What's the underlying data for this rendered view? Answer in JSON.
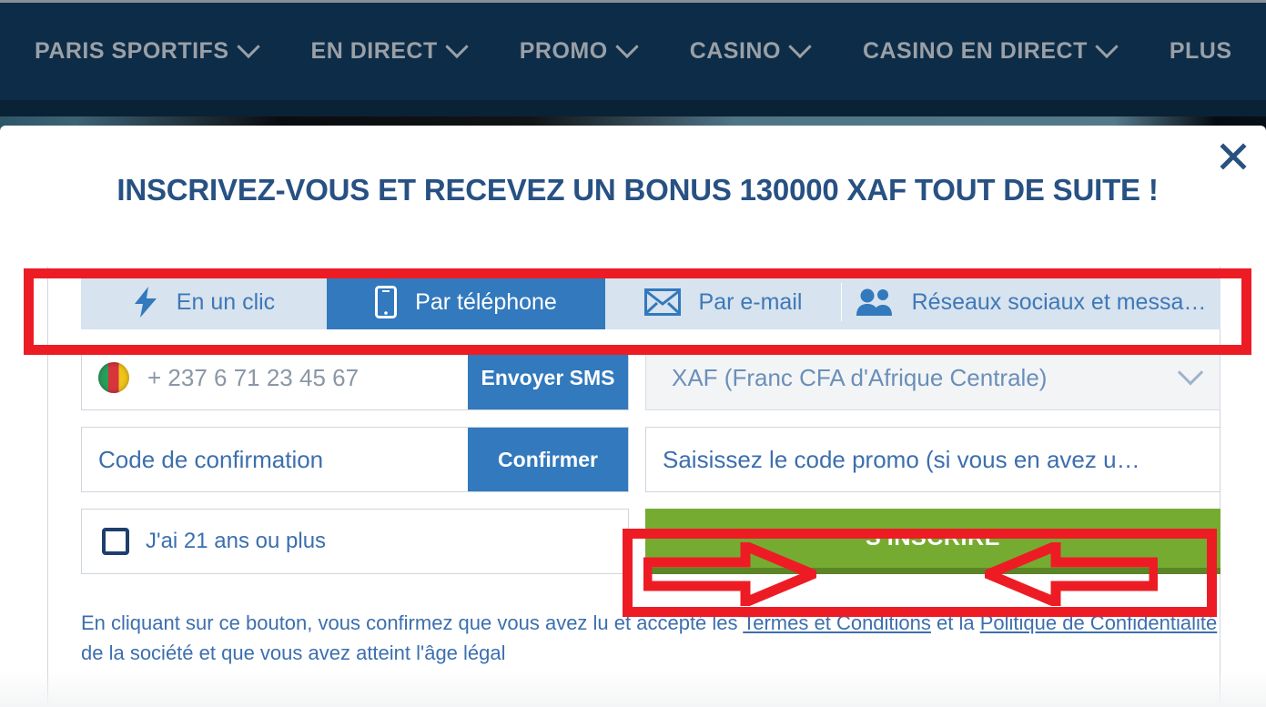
{
  "header": {
    "nav_items": [
      {
        "label": "PARIS SPORTIFS",
        "caret": "chevron-down-icon"
      },
      {
        "label": "EN DIRECT",
        "caret": "chevron-down-icon"
      },
      {
        "label": "PROMO",
        "caret": "chevron-down-icon"
      },
      {
        "label": "CASINO",
        "caret": "chevron-down-icon"
      },
      {
        "label": "CASINO EN DIRECT",
        "caret": "chevron-down-icon"
      },
      {
        "label": "PLUS",
        "caret": "chevron-down-icon"
      }
    ],
    "background_color": "#0d2c47",
    "text_color": "#9aa0a6"
  },
  "modal": {
    "title": "INSCRIVEZ-VOUS ET RECEVEZ UN BONUS 130000 XAF TOUT DE SUITE !",
    "title_color": "#275183",
    "close_icon": "close-icon",
    "tabs": [
      {
        "label": "En un clic",
        "icon": "lightning-bolt-icon",
        "active": false
      },
      {
        "label": "Par téléphone",
        "icon": "mobile-phone-icon",
        "active": true
      },
      {
        "label": "Par e-mail",
        "icon": "envelope-icon",
        "active": false
      },
      {
        "label": "Réseaux sociaux et messa…",
        "icon": "people-group-icon",
        "active": false
      }
    ],
    "tab_active_color": "#3279bd",
    "tab_inactive_background": "#d7e3ee",
    "form": {
      "phone_placeholder": "+ 237 6 71 23 45 67",
      "phone_flag": "cameroon-flag-icon",
      "send_sms_label": "Envoyer SMS",
      "currency_value": "XAF (Franc CFA d'Afrique Centrale)",
      "currency_caret": "chevron-down-icon",
      "confirmation_code_placeholder": "Code de confirmation",
      "confirm_label": "Confirmer",
      "promo_code_placeholder": "Saisissez le code promo (si vous en avez u…",
      "age_checkbox_label": "J'ai 21 ans ou plus",
      "age_checkbox_checked": false,
      "register_label": "S'INSCRIRE",
      "register_color": "#76ab32"
    },
    "legal": {
      "part1": "En cliquant sur ce bouton, vous confirmez que vous avez lu et accepté les ",
      "link1": "Termes et Conditions",
      "part2": " et la ",
      "link2": "Politique de Confidentialité",
      "part3": " de la société et que vous avez atteint l'âge légal"
    }
  },
  "annotations": {
    "highlight_color": "#ed1c24",
    "tabs_highlight": "red-rectangle-highlight",
    "submit_highlight": "red-rectangle-highlight",
    "arrow_left": "red-arrow-right-pointing",
    "arrow_right": "red-arrow-left-pointing"
  }
}
